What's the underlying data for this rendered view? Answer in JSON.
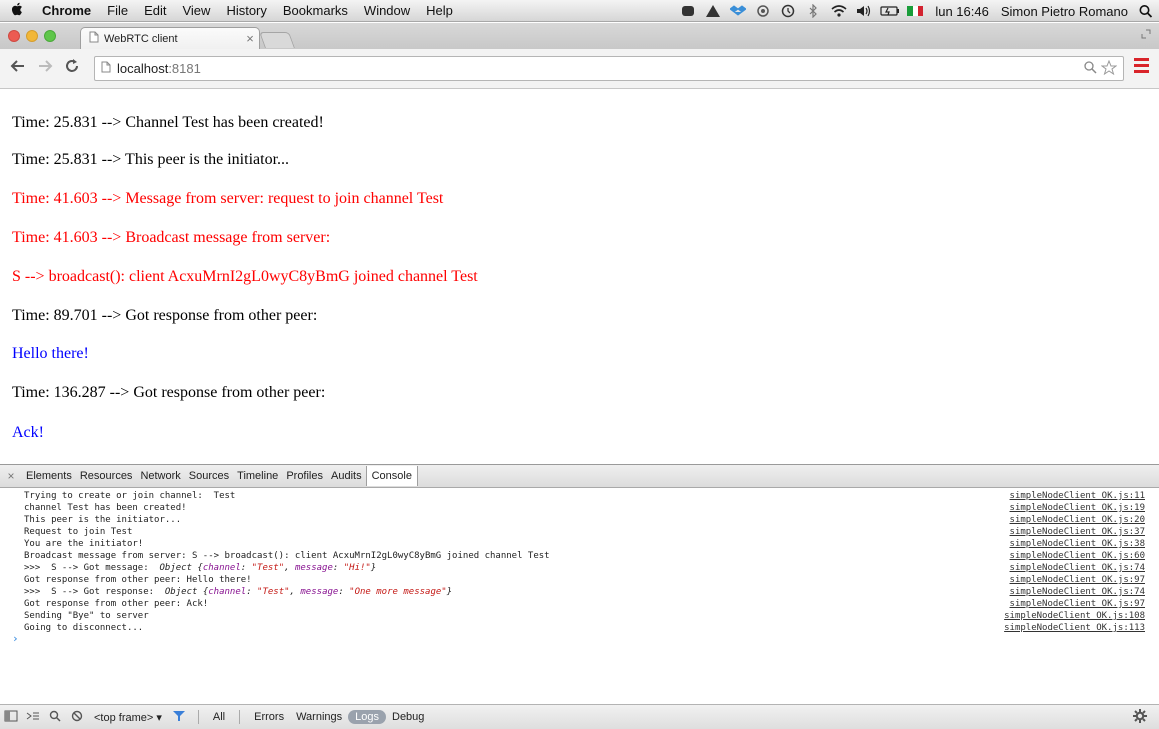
{
  "menubar": {
    "app_name": "Chrome",
    "menus": [
      "File",
      "Edit",
      "View",
      "History",
      "Bookmarks",
      "Window",
      "Help"
    ],
    "status_icons": [
      "app-icon-1",
      "app-icon-2",
      "dropbox-icon",
      "app-icon-3",
      "time-machine-icon",
      "bluetooth-icon",
      "wifi-icon",
      "volume-icon",
      "battery-icon",
      "italian-flag-icon"
    ],
    "clock": "lun 16:46",
    "user": "Simon Pietro Romano"
  },
  "tab": {
    "title": "WebRTC client",
    "close_glyph": "×"
  },
  "toolbar": {
    "url_host": "localhost",
    "url_port": ":8181"
  },
  "page": {
    "lines": [
      {
        "text": "Time: 25.831 --> Channel Test has been created!",
        "color": "#000000"
      },
      {
        "text": "Time: 25.831 --> This peer is the initiator...",
        "color": "#000000"
      },
      {
        "text": "Time: 41.603 --> Message from server: request to join channel Test",
        "color": "#ff0000"
      },
      {
        "text": "Time: 41.603 --> Broadcast message from server:",
        "color": "#ff0000"
      },
      {
        "text": "S --> broadcast(): client AcxuMrnI2gL0wyC8yBmG joined channel Test",
        "color": "#ff0000"
      },
      {
        "text": "Time: 89.701 --> Got response from other peer:",
        "color": "#000000"
      },
      {
        "text": "Hello there!",
        "color": "#0000ff"
      },
      {
        "text": "Time: 136.287 --> Got response from other peer:",
        "color": "#000000"
      },
      {
        "text": "Ack!",
        "color": "#0000ff"
      }
    ]
  },
  "devtools": {
    "tabs": [
      "Elements",
      "Resources",
      "Network",
      "Sources",
      "Timeline",
      "Profiles",
      "Audits",
      "Console"
    ],
    "active_tab": "Console",
    "console_rows": [
      {
        "message": "Trying to create or join channel:  Test",
        "source": "simpleNodeClient_OK.js:11"
      },
      {
        "message": "channel Test has been created!",
        "source": "simpleNodeClient_OK.js:19"
      },
      {
        "message": "This peer is the initiator...",
        "source": "simpleNodeClient_OK.js:20"
      },
      {
        "message": "Request to join Test",
        "source": "simpleNodeClient_OK.js:37"
      },
      {
        "message": "You are the initiator!",
        "source": "simpleNodeClient_OK.js:38"
      },
      {
        "message": "Broadcast message from server: S --> broadcast(): client AcxuMrnI2gL0wyC8yBmG joined channel Test",
        "source": "simpleNodeClient_OK.js:60"
      },
      {
        "message_prefix": ">>>  S --> Got message:  ",
        "object_label": "Object",
        "object_channel_key": "channel",
        "object_channel_value": "\"Test\"",
        "object_message_key": "message",
        "object_message_value": "\"Hi!\"",
        "source": "simpleNodeClient_OK.js:74"
      },
      {
        "message": "Got response from other peer: Hello there!",
        "source": "simpleNodeClient_OK.js:97"
      },
      {
        "message_prefix": ">>>  S --> Got response:  ",
        "object_label": "Object",
        "object_channel_key": "channel",
        "object_channel_value": "\"Test\"",
        "object_message_key": "message",
        "object_message_value": "\"One more message\"",
        "source": "simpleNodeClient_OK.js:74"
      },
      {
        "message": "Got response from other peer: Ack!",
        "source": "simpleNodeClient_OK.js:97"
      },
      {
        "message": "Sending \"Bye\" to server",
        "source": "simpleNodeClient_OK.js:108"
      },
      {
        "message": "Going to disconnect...",
        "source": "simpleNodeClient_OK.js:113"
      }
    ],
    "prompt": "›",
    "status_bar": {
      "frame_select": "<top frame> ▾",
      "filters": [
        "All",
        "Errors",
        "Warnings",
        "Logs",
        "Debug"
      ],
      "active_filter": "Logs"
    }
  }
}
